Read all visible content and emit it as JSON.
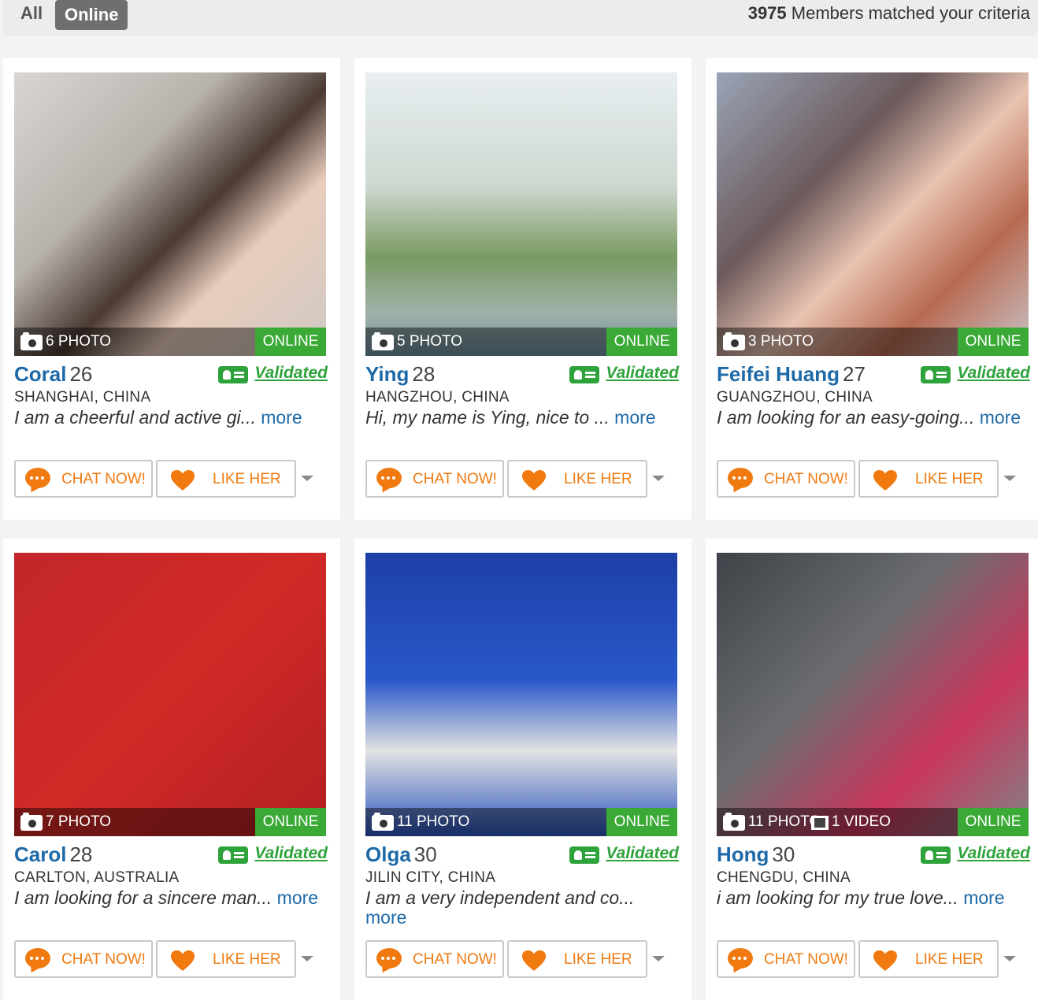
{
  "filters": {
    "all": "All",
    "online": "Online"
  },
  "match": {
    "count": "3975",
    "text": "Members matched your criteria"
  },
  "common": {
    "online_badge": "ONLINE",
    "validated": "Validated",
    "more": "more",
    "chat_button": "CHAT NOW!",
    "like_button": "LIKE HER"
  },
  "colors": {
    "accent_orange": "#f07a10",
    "online_green": "#3aa935",
    "name_blue": "#1e6aa8"
  },
  "members": [
    {
      "name": "Coral",
      "age": "26",
      "location": "SHANGHAI, CHINA",
      "about": "I am a cheerful and active gi...",
      "photos": "6 PHOTO",
      "video": ""
    },
    {
      "name": "Ying",
      "age": "28",
      "location": "HANGZHOU, CHINA",
      "about": "Hi, my name is Ying, nice to ...",
      "photos": "5 PHOTO",
      "video": ""
    },
    {
      "name": "Feifei Huang",
      "age": "27",
      "location": "GUANGZHOU, CHINA",
      "about": "I am looking for an easy-going...",
      "photos": "3 PHOTO",
      "video": ""
    },
    {
      "name": "Carol",
      "age": "28",
      "location": "CARLTON, AUSTRALIA",
      "about": "I am looking for a sincere man...",
      "photos": "7 PHOTO",
      "video": ""
    },
    {
      "name": "Olga",
      "age": "30",
      "location": "JILIN CITY, CHINA",
      "about": "I am a very independent and co...",
      "photos": "11 PHOTO",
      "video": ""
    },
    {
      "name": "Hong",
      "age": "30",
      "location": "CHENGDU, CHINA",
      "about": "i am looking for my true love...",
      "photos": "11 PHOTO",
      "video": "1 VIDEO"
    }
  ]
}
